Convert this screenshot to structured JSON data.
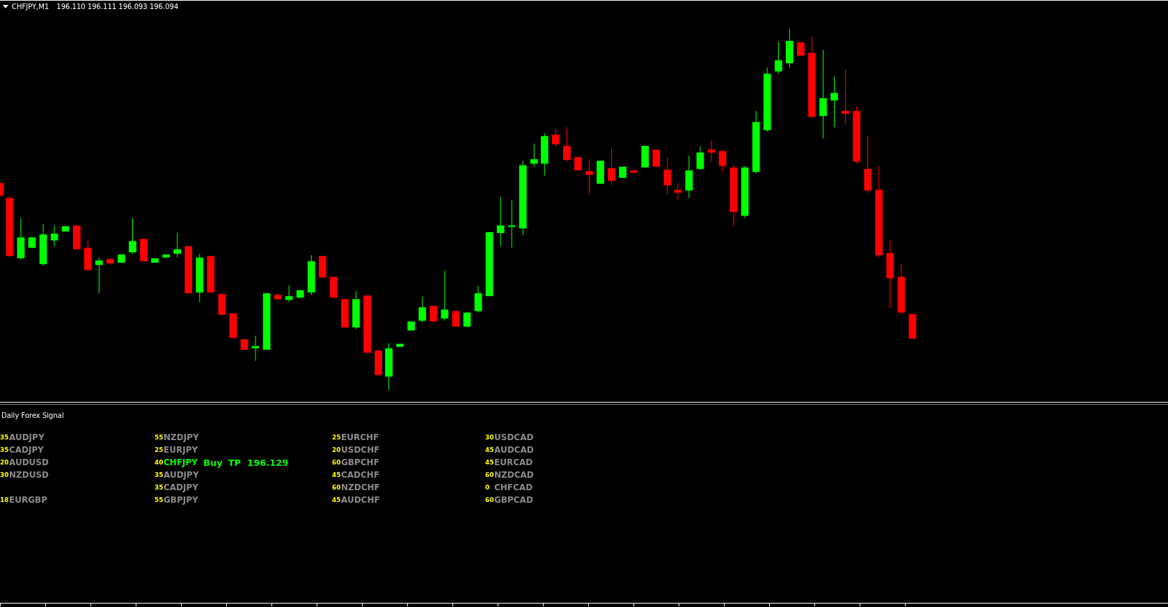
{
  "chart": {
    "symbol": "CHFJPY,M1",
    "quotes": "196.110 196.111 196.093 196.094"
  },
  "indicator": {
    "title": "Daily Forex Signal",
    "columns": [
      {
        "rows": [
          {
            "kind": "pair",
            "score": "35",
            "pair": "AUDJPY",
            "active": false
          },
          {
            "kind": "pair",
            "score": "35",
            "pair": "CADJPY",
            "active": false
          },
          {
            "kind": "pair",
            "score": "20",
            "pair": "AUDUSD",
            "active": false
          },
          {
            "kind": "pair",
            "score": "30",
            "pair": "NZDUSD",
            "active": false
          },
          {
            "kind": "blank"
          },
          {
            "kind": "pair",
            "score": "18",
            "pair": "EURGBP",
            "active": false
          }
        ]
      },
      {
        "rows": [
          {
            "kind": "pair",
            "score": "55",
            "pair": "NZDJPY",
            "active": false
          },
          {
            "kind": "pair",
            "score": "25",
            "pair": "EURJPY",
            "active": false
          },
          {
            "kind": "pair",
            "score": "40",
            "pair": "CHFJPY",
            "active": true,
            "signal": "Buy",
            "target": "TP  196.129"
          },
          {
            "kind": "pair",
            "score": "35",
            "pair": "AUDJPY",
            "active": false
          },
          {
            "kind": "pair",
            "score": "35",
            "pair": "CADJPY",
            "active": false
          },
          {
            "kind": "pair",
            "score": "55",
            "pair": "GBPJPY",
            "active": false
          }
        ]
      },
      {
        "rows": [
          {
            "kind": "pair",
            "score": "25",
            "pair": "EURCHF",
            "active": false
          },
          {
            "kind": "pair",
            "score": "20",
            "pair": "USDCHF",
            "active": false
          },
          {
            "kind": "pair",
            "score": "60",
            "pair": "GBPCHF",
            "active": false
          },
          {
            "kind": "pair",
            "score": "45",
            "pair": "CADCHF",
            "active": false
          },
          {
            "kind": "pair",
            "score": "60",
            "pair": "NZDCHF",
            "active": false
          },
          {
            "kind": "pair",
            "score": "45",
            "pair": "AUDCHF",
            "active": false
          }
        ]
      },
      {
        "rows": [
          {
            "kind": "pair",
            "score": "30",
            "pair": "USDCAD",
            "active": false
          },
          {
            "kind": "pair",
            "score": "45",
            "pair": "AUDCAD",
            "active": false
          },
          {
            "kind": "pair",
            "score": "45",
            "pair": "EURCAD",
            "active": false
          },
          {
            "kind": "pair",
            "score": "60",
            "pair": "NZDCAD",
            "active": false
          },
          {
            "kind": "pair",
            "score": "0",
            "pair": "CHFCAD",
            "active": false
          },
          {
            "kind": "pair",
            "score": "60",
            "pair": "GBPCAD",
            "active": false
          }
        ]
      }
    ]
  }
}
